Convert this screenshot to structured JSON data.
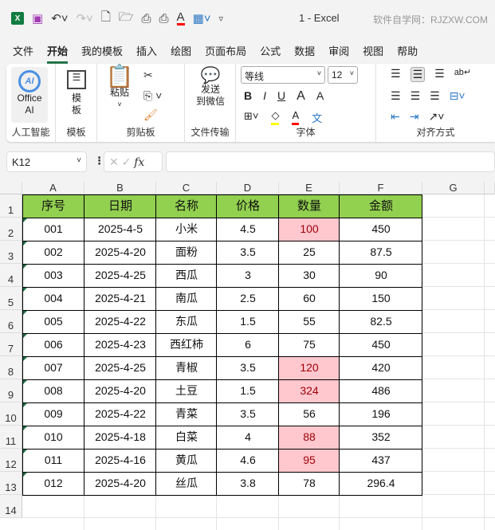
{
  "titlebar": {
    "doc": "1  -  Excel",
    "site": "软件自学网：RJZXW.COM",
    "icons": [
      "excel-logo-icon",
      "save-icon",
      "undo-icon",
      "redo-icon",
      "new-file-icon",
      "open-folder-icon",
      "print-preview-icon",
      "print-icon",
      "font-color-icon",
      "table-icon",
      "customize-icon"
    ],
    "excel_letter": "X"
  },
  "tabs": [
    "文件",
    "开始",
    "我的模板",
    "插入",
    "绘图",
    "页面布局",
    "公式",
    "数据",
    "审阅",
    "视图",
    "帮助"
  ],
  "active_tab": 1,
  "ribbon": {
    "ai": {
      "label1": "Office",
      "label2": "AI",
      "group": "人工智能",
      "logo": "AI"
    },
    "template": {
      "label1": "模",
      "label2": "板",
      "group": "模板"
    },
    "clipboard": {
      "paste1": "粘贴",
      "group": "剪贴板"
    },
    "transfer": {
      "label1": "发送",
      "label2": "到微信",
      "group": "文件传输"
    },
    "font": {
      "name": "等线",
      "size": "12",
      "bold": "B",
      "italic": "I",
      "underline": "U",
      "grow": "A",
      "shrink": "A",
      "color": "A",
      "phonetic": "文",
      "group": "字体",
      "highlight_color": "#ffff00",
      "font_color": "#ff0000"
    },
    "align": {
      "group": "对齐方式"
    }
  },
  "formula": {
    "namebox": "K12",
    "fx": "fx",
    "value": ""
  },
  "columns": [
    "A",
    "B",
    "C",
    "D",
    "E",
    "F",
    "G"
  ],
  "rows": [
    "1",
    "2",
    "3",
    "4",
    "5",
    "6",
    "7",
    "8",
    "9",
    "10",
    "11",
    "12",
    "13",
    "14"
  ],
  "header": [
    "序号",
    "日期",
    "名称",
    "价格",
    "数量",
    "金额"
  ],
  "data": [
    [
      "001",
      "2025-4-5",
      "小米",
      "4.5",
      "100",
      "450"
    ],
    [
      "002",
      "2025-4-20",
      "面粉",
      "3.5",
      "25",
      "87.5"
    ],
    [
      "003",
      "2025-4-25",
      "西瓜",
      "3",
      "30",
      "90"
    ],
    [
      "004",
      "2025-4-21",
      "南瓜",
      "2.5",
      "60",
      "150"
    ],
    [
      "005",
      "2025-4-22",
      "东瓜",
      "1.5",
      "55",
      "82.5"
    ],
    [
      "006",
      "2025-4-23",
      "西红柿",
      "6",
      "75",
      "450"
    ],
    [
      "007",
      "2025-4-25",
      "青椒",
      "3.5",
      "120",
      "420"
    ],
    [
      "008",
      "2025-4-20",
      "土豆",
      "1.5",
      "324",
      "486"
    ],
    [
      "009",
      "2025-4-22",
      "青菜",
      "3.5",
      "56",
      "196"
    ],
    [
      "010",
      "2025-4-18",
      "白菜",
      "4",
      "88",
      "352"
    ],
    [
      "011",
      "2025-4-16",
      "黄瓜",
      "4.6",
      "95",
      "437"
    ],
    [
      "012",
      "2025-4-20",
      "丝瓜",
      "3.8",
      "78",
      "296.4"
    ]
  ],
  "colors": {
    "header_fill": "#92d050",
    "highlight_fill": "#ffc7ce",
    "highlight_text": "#9c0006"
  },
  "highlight_threshold": 80
}
